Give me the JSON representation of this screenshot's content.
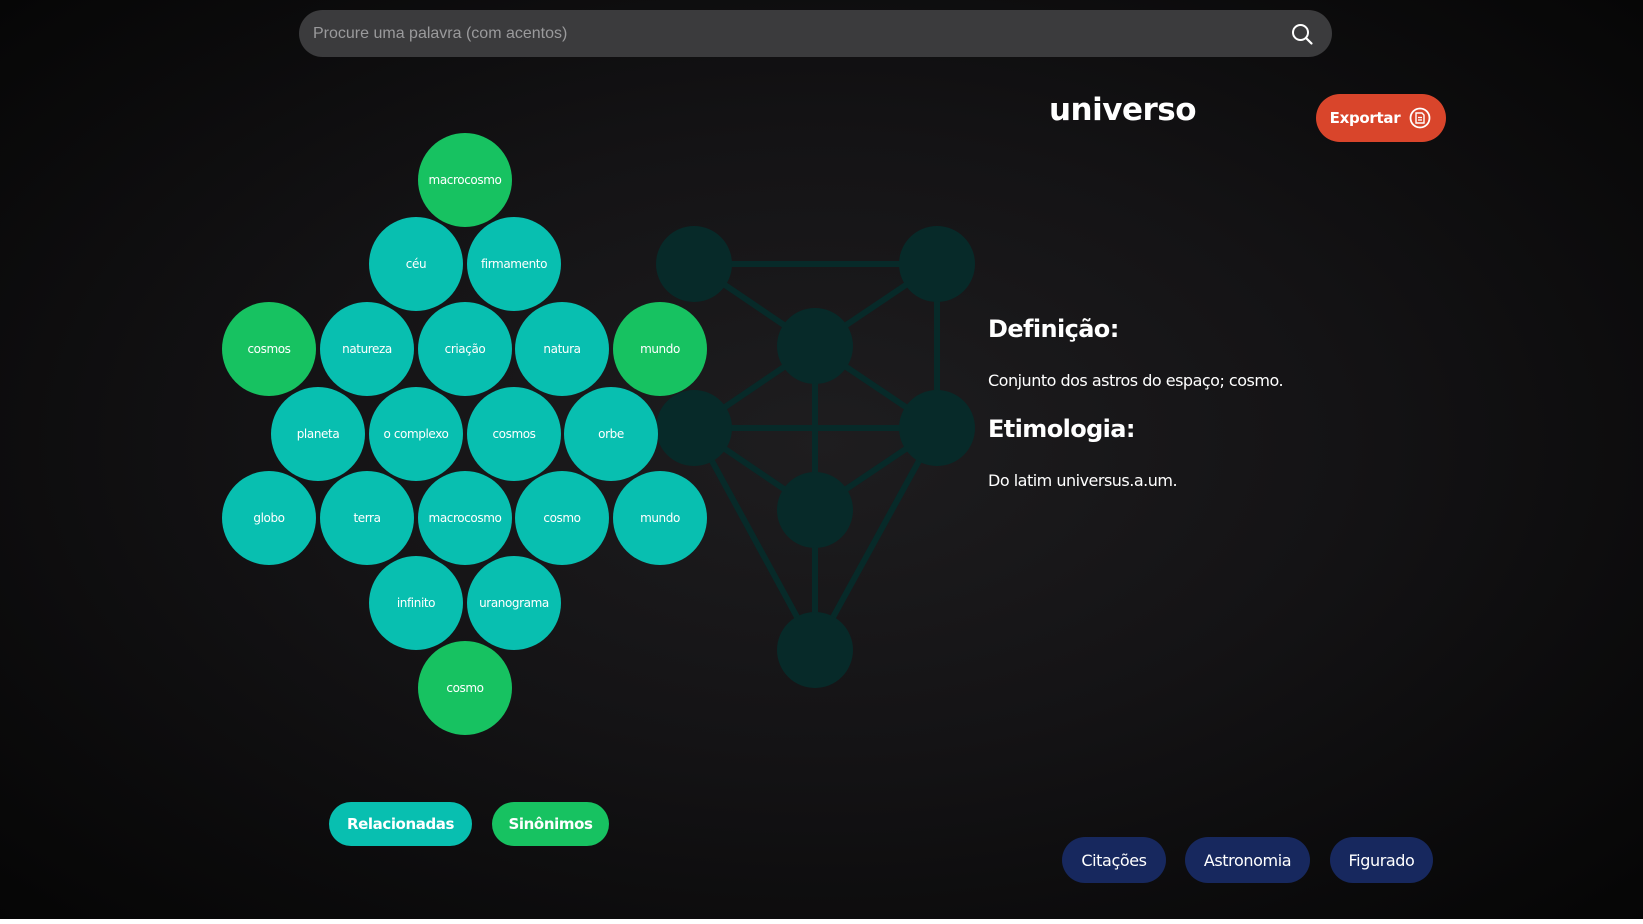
{
  "search": {
    "placeholder": "Procure uma palavra (com acentos)",
    "value": ""
  },
  "word": {
    "title": "universo"
  },
  "export_button": {
    "label": "Exportar",
    "icon": "pdf-icon"
  },
  "bubbles": [
    {
      "label": "macrocosmo",
      "color": "green"
    },
    {
      "label": "céu",
      "color": "teal"
    },
    {
      "label": "firmamento",
      "color": "teal"
    },
    {
      "label": "cosmos",
      "color": "green"
    },
    {
      "label": "natureza",
      "color": "teal"
    },
    {
      "label": "criação",
      "color": "teal"
    },
    {
      "label": "natura",
      "color": "teal"
    },
    {
      "label": "mundo",
      "color": "green"
    },
    {
      "label": "planeta",
      "color": "teal"
    },
    {
      "label": "o complexo",
      "color": "teal"
    },
    {
      "label": "cosmos",
      "color": "teal"
    },
    {
      "label": "orbe",
      "color": "teal"
    },
    {
      "label": "globo",
      "color": "teal"
    },
    {
      "label": "terra",
      "color": "teal"
    },
    {
      "label": "macrocosmo",
      "color": "teal"
    },
    {
      "label": "cosmo",
      "color": "teal"
    },
    {
      "label": "mundo",
      "color": "teal"
    },
    {
      "label": "infinito",
      "color": "teal"
    },
    {
      "label": "uranograma",
      "color": "teal"
    },
    {
      "label": "cosmo",
      "color": "green"
    }
  ],
  "definition": {
    "heading": "Definição:",
    "text": "Conjunto dos astros do espaço; cosmo."
  },
  "etymology": {
    "heading": "Etimologia:",
    "text": "Do latim universus.a.um."
  },
  "filters": {
    "related": "Relacionadas",
    "synonyms": "Sinônimos"
  },
  "tags": [
    "Citações",
    "Astronomia",
    "Figurado"
  ],
  "colors": {
    "background": "#141315",
    "search_bg": "#3b3b3d",
    "teal": "#08bfb0",
    "green": "#17c261",
    "export": "#d9452b",
    "tag_bg": "#17285e",
    "network": "#072a29"
  }
}
